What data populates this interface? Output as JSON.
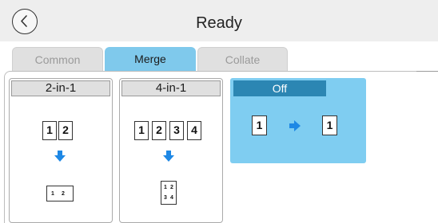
{
  "header": {
    "title": "Ready",
    "back_icon": "chevron-left-icon"
  },
  "tabs": [
    {
      "label": "Common",
      "active": false
    },
    {
      "label": "Merge",
      "active": true
    },
    {
      "label": "Collate",
      "active": false
    }
  ],
  "options": {
    "two_in_one": {
      "label": "2-in-1",
      "source_pages": [
        "1",
        "2"
      ],
      "result_pages": [
        "1",
        "2"
      ],
      "arrow_icon": "arrow-down-icon"
    },
    "four_in_one": {
      "label": "4-in-1",
      "source_pages": [
        "1",
        "2",
        "3",
        "4"
      ],
      "result_pages": [
        "1",
        "2",
        "3",
        "4"
      ],
      "arrow_icon": "arrow-down-icon"
    },
    "off": {
      "label": "Off",
      "selected": true,
      "source_page": "1",
      "result_page": "1",
      "arrow_icon": "arrow-right-icon"
    }
  },
  "colors": {
    "accent": "#7fc9ec",
    "selected_card": "#7fcdf1",
    "selected_label": "#2c86b3",
    "arrow": "#1e88e5"
  }
}
